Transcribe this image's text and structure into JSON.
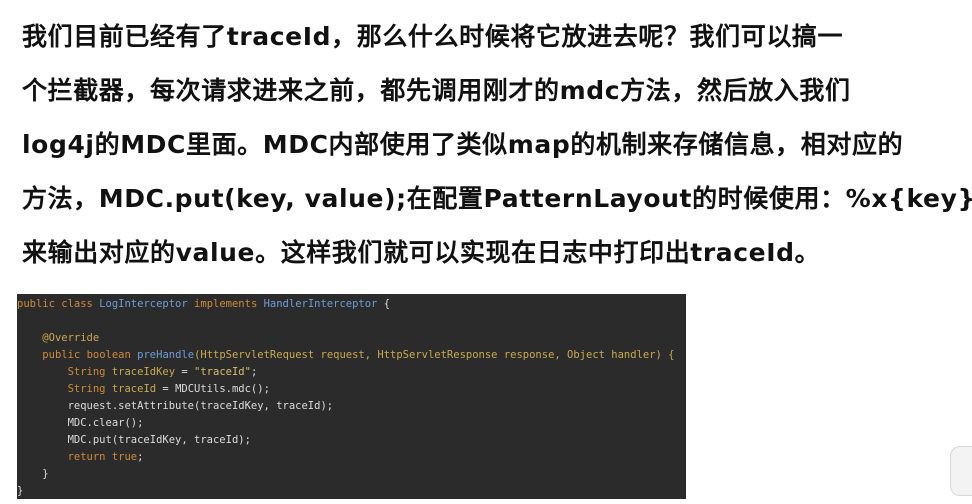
{
  "prose_lines": [
    "我们目前已经有了traceId，那么什么时候将它放进去呢？我们可以搞一",
    "个拦截器，每次请求进来之前，都先调用刚才的mdc方法，然后放入我们",
    "log4j的MDC里面。MDC内部使用了类似map的机制来存储信息，相对应的",
    "方法，MDC.put(key, value);在配置PatternLayout的时候使用：%x{key}",
    "来输出对应的value。这样我们就可以实现在日志中打印出traceId。"
  ],
  "code": {
    "line1": {
      "public": "public",
      "class": "class",
      "class_name": "LogInterceptor",
      "implements": "implements",
      "interface_name": "HandlerInterceptor",
      "brace": "{"
    },
    "line3": {
      "annotation": "@Override"
    },
    "line4": {
      "public": "public",
      "boolean": "boolean",
      "method_name": "preHandle",
      "params": "(HttpServletRequest request, HttpServletResponse response, Object handler) {"
    },
    "line5": {
      "type": "String",
      "var": "traceIdKey",
      "eq": " = ",
      "value": "\"traceId\"",
      "semi": ";"
    },
    "line6": {
      "type": "String",
      "var": "traceId",
      "rest": " = MDCUtils.mdc();"
    },
    "line7": "request.setAttribute(traceIdKey, traceId);",
    "line8": "MDC.clear();",
    "line9": "MDC.put(traceIdKey, traceId);",
    "line10": {
      "return": "return",
      "true": "true",
      "semi": ";"
    },
    "line11": "}",
    "line12": "}"
  }
}
